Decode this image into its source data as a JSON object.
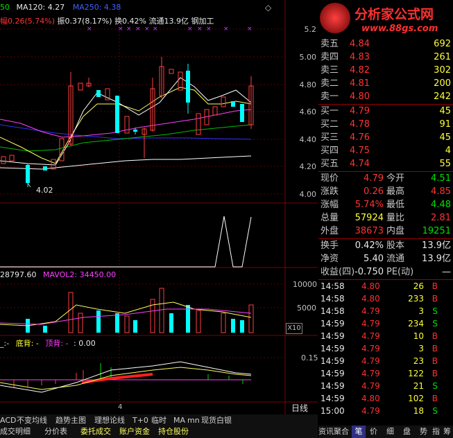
{
  "header": {
    "ma_prefix": "50",
    "ma120": "MA120: 4.27",
    "ma250": "MA250: 4.38",
    "change_pct": "幅0.26(5.74%)",
    "amplitude": "振0.37(8.17%)",
    "turnover": "换0.42%",
    "float_cap": "流通13.9亿",
    "sector": "钢加工",
    "diamond": "◇"
  },
  "logo": {
    "title": "分析家公式网",
    "url": "www.88gs.com"
  },
  "price_axis": [
    "5.2",
    "5.00",
    "4.80",
    "4.60",
    "4.40",
    "4.20",
    "4.00"
  ],
  "low_label": "4.02",
  "vol_header": {
    "vol": "28797.60",
    "mavol2": "MAVOL2: 34450.00"
  },
  "vol_axis": [
    "10000",
    "5000"
  ],
  "x10": "X10",
  "macd_header": {
    "a": "_:-",
    "b": "底背: -",
    "c": "顶背: -",
    "d": ": 0.00"
  },
  "macd_axis": "0.15",
  "x_tick": "4",
  "period_label": "日线",
  "bottom_tabs1": [
    "ACD",
    "不变均线",
    "趋势主图",
    "理想论线",
    "T+0",
    "临时",
    "MA",
    "mn",
    "现货白银"
  ],
  "bottom_tabs2": [
    "成交明细",
    "分价表",
    "委托成交",
    "账户资金",
    "持仓股份"
  ],
  "sell": [
    {
      "label": "卖五",
      "price": "4.84",
      "vol": "692"
    },
    {
      "label": "卖四",
      "price": "4.83",
      "vol": "261"
    },
    {
      "label": "卖三",
      "price": "4.82",
      "vol": "302"
    },
    {
      "label": "卖二",
      "price": "4.81",
      "vol": "200"
    },
    {
      "label": "卖一",
      "price": "4.80",
      "vol": "242"
    }
  ],
  "buy": [
    {
      "label": "买一",
      "price": "4.79",
      "vol": "45"
    },
    {
      "label": "买二",
      "price": "4.78",
      "vol": "91"
    },
    {
      "label": "买三",
      "price": "4.76",
      "vol": "45"
    },
    {
      "label": "买四",
      "price": "4.75",
      "vol": "4"
    },
    {
      "label": "买五",
      "price": "4.74",
      "vol": "55"
    }
  ],
  "stats": [
    {
      "l1": "现价",
      "v1": "4.79",
      "c1": "red",
      "l2": "今开",
      "v2": "4.51",
      "c2": "green"
    },
    {
      "l1": "涨跌",
      "v1": "0.26",
      "c1": "red",
      "l2": "最高",
      "v2": "4.85",
      "c2": "red"
    },
    {
      "l1": "涨幅",
      "v1": "5.74%",
      "c1": "red",
      "l2": "最低",
      "v2": "4.48",
      "c2": "green"
    },
    {
      "l1": "总量",
      "v1": "57924",
      "c1": "yellow",
      "l2": "量比",
      "v2": "2.81",
      "c2": "red"
    },
    {
      "l1": "外盘",
      "v1": "38673",
      "c1": "red",
      "l2": "内盘",
      "v2": "19251",
      "c2": "green"
    }
  ],
  "stats2": [
    {
      "l1": "换手",
      "v1": "0.42%",
      "l2": "股本",
      "v2": "13.9亿"
    },
    {
      "l1": "净资",
      "v1": "5.40",
      "l2": "流通",
      "v2": "13.9亿"
    },
    {
      "l1": "收益(四)",
      "v1": "-0.750",
      "l2": "PE(动)",
      "v2": "—"
    }
  ],
  "ticks": [
    {
      "time": "14:58",
      "price": "4.80",
      "vol": "26",
      "side": "B"
    },
    {
      "time": "14:58",
      "price": "4.80",
      "vol": "233",
      "side": "B"
    },
    {
      "time": "14:58",
      "price": "4.79",
      "vol": "3",
      "side": "S"
    },
    {
      "time": "14:59",
      "price": "4.79",
      "vol": "234",
      "side": "S"
    },
    {
      "time": "14:59",
      "price": "4.79",
      "vol": "10",
      "side": "B"
    },
    {
      "time": "14:59",
      "price": "4.79",
      "vol": "3",
      "side": "B"
    },
    {
      "time": "14:59",
      "price": "4.79",
      "vol": "23",
      "side": "B"
    },
    {
      "time": "14:59",
      "price": "4.79",
      "vol": "122",
      "side": "B"
    },
    {
      "time": "14:59",
      "price": "4.79",
      "vol": "21",
      "side": "S"
    },
    {
      "time": "14:59",
      "price": "4.80",
      "vol": "102",
      "side": "B"
    },
    {
      "time": "15:00",
      "price": "4.79",
      "vol": "18",
      "side": "S"
    }
  ],
  "right_tabs": [
    "资讯聚合",
    "笔",
    "价",
    "细",
    "盘",
    "势",
    "指",
    "筹"
  ]
}
